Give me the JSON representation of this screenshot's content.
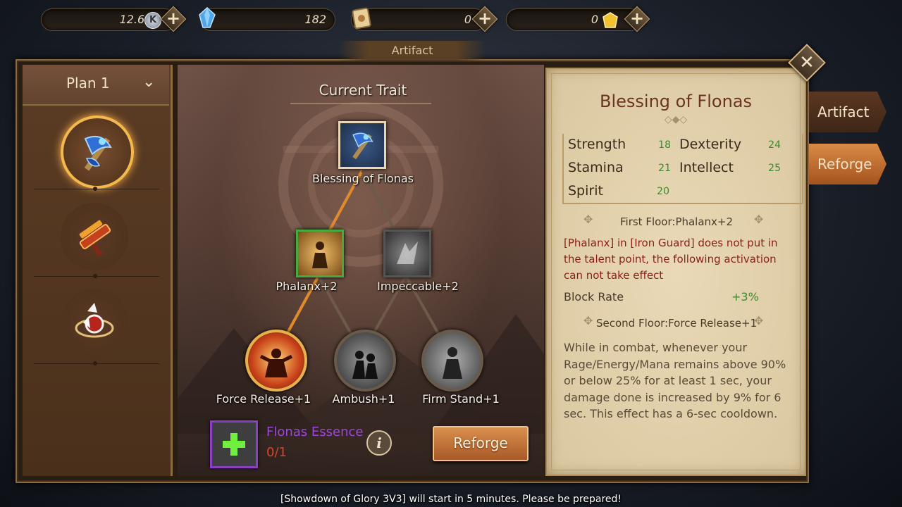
{
  "currencies": {
    "coins": {
      "value": "12.6M",
      "icon": "k-coin-icon"
    },
    "crystals": {
      "value": "182",
      "icon": "blue-crystal-icon"
    },
    "scroll": {
      "value": "0",
      "icon": "scroll-icon"
    },
    "gold": {
      "value": "0",
      "icon": "gold-gem-icon"
    }
  },
  "window": {
    "title": "Artifact",
    "close_icon": "close-icon"
  },
  "plan": {
    "label": "Plan 1",
    "icon": "chevron-down-icon"
  },
  "artifacts": [
    {
      "name": "blue-axe-artifact",
      "selected": true
    },
    {
      "name": "red-gun-artifact",
      "selected": false
    },
    {
      "name": "white-red-orb-artifact",
      "selected": false
    }
  ],
  "trait_tree": {
    "header": "Current Trait",
    "root": {
      "label": "Blessing of Flonas"
    },
    "tier1": [
      {
        "label": "Phalanx+2",
        "active": true
      },
      {
        "label": "Impeccable+2",
        "active": false
      }
    ],
    "tier2": [
      {
        "label": "Force Release+1",
        "active": true
      },
      {
        "label": "Ambush+1",
        "active": false
      },
      {
        "label": "Firm Stand+1",
        "active": false
      }
    ]
  },
  "essence": {
    "name": "Flonas Essence",
    "count": "0/1",
    "icon": "plus-icon",
    "info_icon": "info-icon"
  },
  "reforge_button": "Reforge",
  "detail": {
    "title": "Blessing of Flonas",
    "stats": [
      {
        "name": "Strength",
        "value": "18"
      },
      {
        "name": "Dexterity",
        "value": "24"
      },
      {
        "name": "Stamina",
        "value": "21"
      },
      {
        "name": "Intellect",
        "value": "25"
      },
      {
        "name": "Spirit",
        "value": "20"
      }
    ],
    "first_floor": "First Floor:Phalanx+2",
    "warning": "[Phalanx] in [Iron Guard] does not put in the talent point, the following activation can not take effect",
    "block_rate_label": "Block Rate",
    "block_rate_value": "+3%",
    "second_floor": "Second Floor:Force Release+1",
    "description": "While in combat, whenever your Rage/Energy/Mana remains above 90% or below 25% for at least 1 sec, your damage done is increased by 9% for 6 sec. This effect has a 6-sec cooldown."
  },
  "side_tabs": [
    {
      "label": "Artifact",
      "active": false
    },
    {
      "label": "Reforge",
      "active": true
    }
  ],
  "notice": "[Showdown of Glory 3V3] will start in 5 minutes. Please be prepared!",
  "colors": {
    "accent": "#c4884c",
    "parchment": "#e2d3b0",
    "stat_green": "#3a8a2e",
    "warning_red": "#8b1f16",
    "essence_purple": "#9b48d8"
  }
}
